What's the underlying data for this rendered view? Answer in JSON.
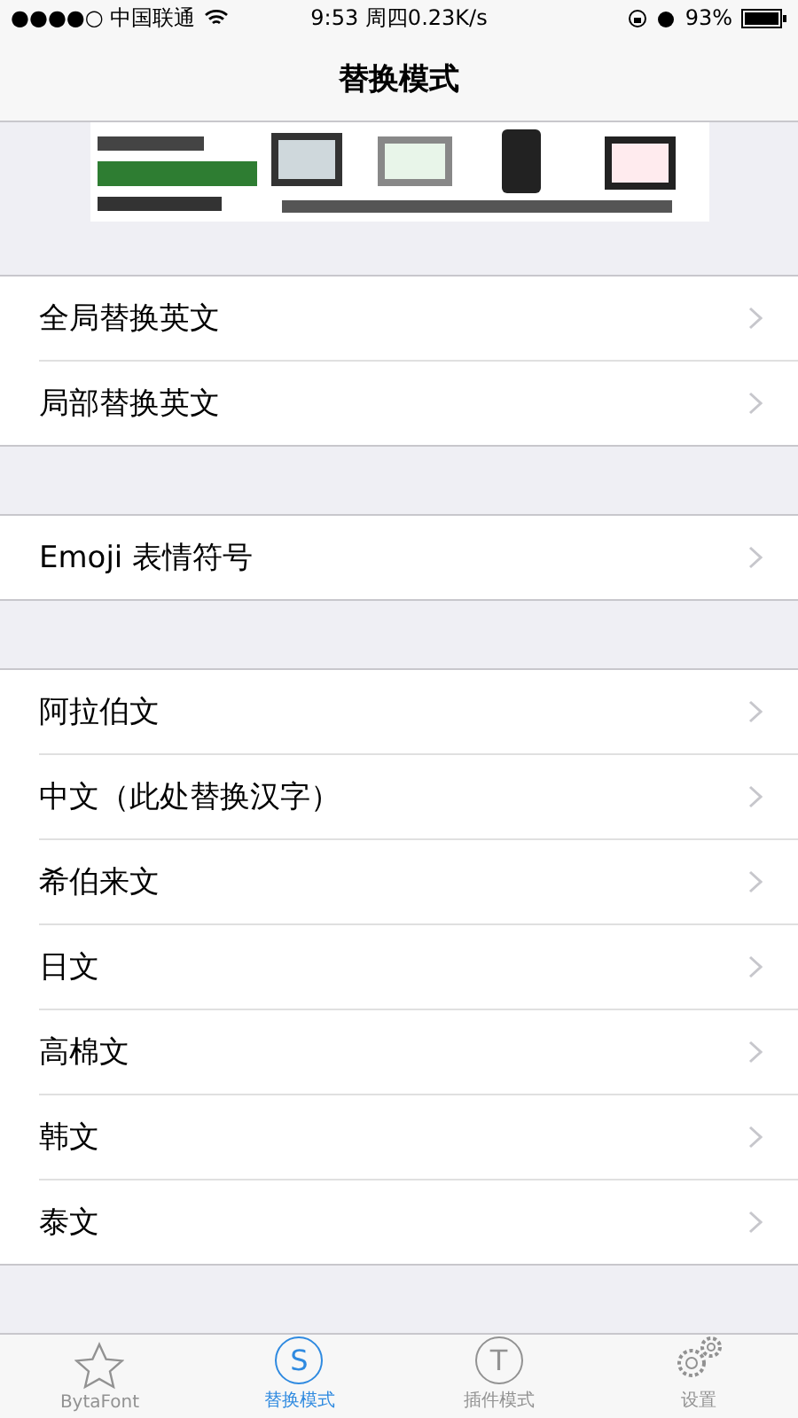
{
  "status_bar": {
    "carrier": "●●●●○ 中国联通",
    "time": "9:53 周四0.23K/s",
    "battery": "93%"
  },
  "nav": {
    "title": "替换模式"
  },
  "sections": [
    {
      "rows": [
        "全局替换英文",
        "局部替换英文"
      ]
    },
    {
      "rows": [
        "Emoji 表情符号"
      ]
    },
    {
      "rows": [
        "阿拉伯文",
        "中文（此处替换汉字）",
        "希伯来文",
        "日文",
        "高棉文",
        "韩文",
        "泰文"
      ]
    }
  ],
  "tabs": [
    {
      "kind": "star",
      "label": "BytaFont",
      "selected": false
    },
    {
      "kind": "letter",
      "glyph": "S",
      "label": "替换模式",
      "selected": true
    },
    {
      "kind": "letter",
      "glyph": "T",
      "label": "插件模式",
      "selected": false
    },
    {
      "kind": "gears",
      "label": "设置",
      "selected": false
    }
  ]
}
